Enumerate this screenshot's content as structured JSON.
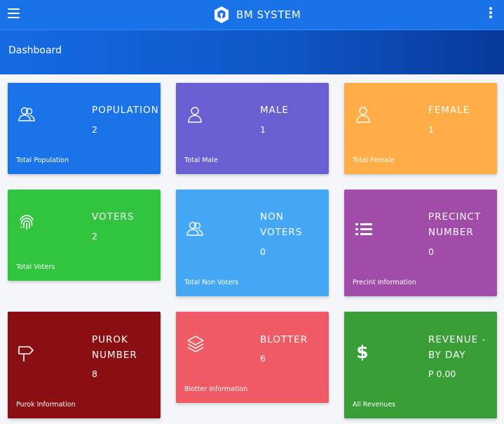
{
  "app": {
    "brand": "BM SYSTEM"
  },
  "page": {
    "title": "Dashboard"
  },
  "cards": [
    {
      "label": "POPULATION",
      "value": "2",
      "footer": "Total Population",
      "icon": "users-icon",
      "color": "#1a73e8"
    },
    {
      "label": "MALE",
      "value": "1",
      "footer": "Total Male",
      "icon": "user-icon",
      "color": "#6a5fd2"
    },
    {
      "label": "FEMALE",
      "value": "1",
      "footer": "Total Female",
      "icon": "user-icon",
      "color": "#ffad47"
    },
    {
      "label": "VOTERS",
      "value": "2",
      "footer": "Total Voters",
      "icon": "fingerprint-icon",
      "color": "#31c43f"
    },
    {
      "label_line1": "NON",
      "label_line2": "VOTERS",
      "value": "0",
      "footer": "Total Non Voters",
      "icon": "users-icon",
      "color": "#43a7f5"
    },
    {
      "label_line1": "PRECINCT",
      "label_line2": "NUMBER",
      "value": "0",
      "footer": "Precint Information",
      "icon": "list-icon",
      "color": "#a04ca8"
    },
    {
      "label_line1": "PUROK",
      "label_line2": "NUMBER",
      "value": "8",
      "footer": "Purok Information",
      "icon": "signpost-icon",
      "color": "#8a0f12"
    },
    {
      "label": "BLOTTER",
      "value": "6",
      "footer": "Blotter Information",
      "icon": "layers-icon",
      "color": "#f05a64"
    },
    {
      "label_line1": "REVENUE -",
      "label_line2": "BY DAY",
      "value": "P 0.00",
      "footer": "All Revenues",
      "icon": "dollar-icon",
      "color": "#3a9e37"
    }
  ]
}
